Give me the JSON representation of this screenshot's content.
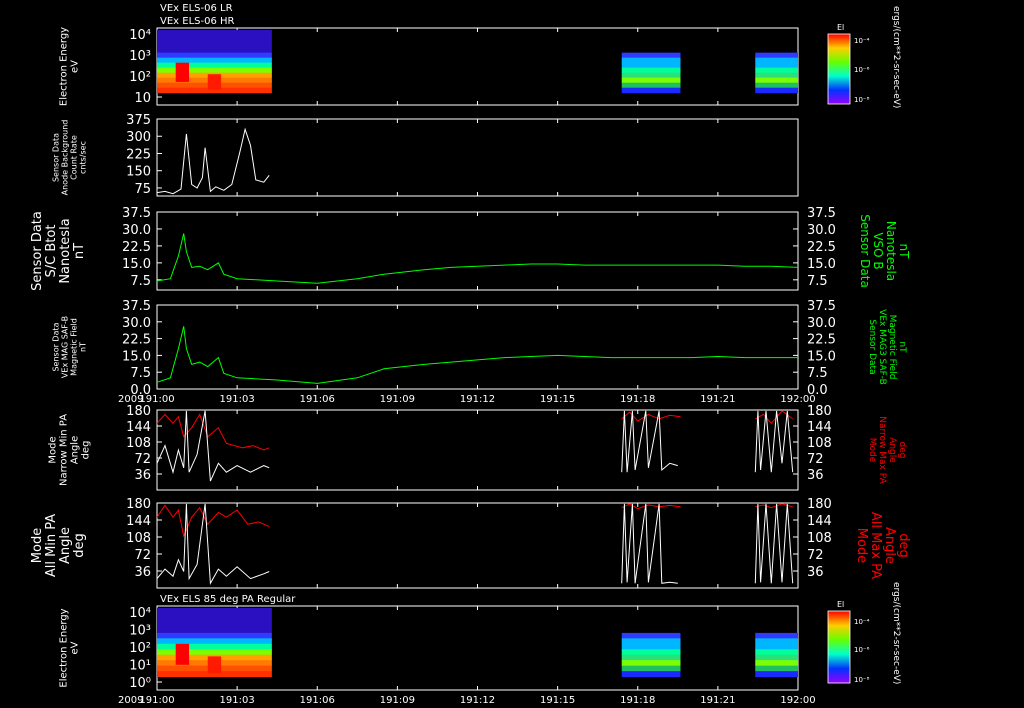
{
  "headers": {
    "top_line1": "VEx ELS-06 LR",
    "top_line2": "VEx ELS-06 HR",
    "bottom_title": "VEx ELS 85 deg PA Regular"
  },
  "colorbars": [
    {
      "title": "El",
      "ticks": [
        "10⁻⁴",
        "10⁻⁶",
        "10⁻⁸"
      ],
      "units": "ergs/(cm**2-sr-sec-eV)"
    },
    {
      "title": "El",
      "ticks": [
        "10⁻⁴",
        "10⁻⁶",
        "10⁻⁸"
      ],
      "units": "ergs/(cm**2-sr-sec-eV)"
    }
  ],
  "time_axis": {
    "year": "2009",
    "ticks": [
      "191:00",
      "191:03",
      "191:06",
      "191:09",
      "191:12",
      "191:15",
      "191:18",
      "191:21",
      "192:00"
    ],
    "range_hours": [
      0,
      1
    ]
  },
  "chart_data": [
    {
      "type": "heatmap",
      "panel": "els_lr_hr_spectrogram",
      "ylabel": [
        "Electron Energy",
        "eV"
      ],
      "yticks": [
        "10⁴",
        "10³",
        "10²",
        "10"
      ],
      "yscale": "log",
      "data_blocks_minutes": [
        [
          0,
          4.3
        ],
        [
          17.4,
          19.6
        ],
        [
          22.4,
          24
        ]
      ]
    },
    {
      "type": "line",
      "panel": "anode_background",
      "ylabel": [
        "Sensor Data",
        "Anode Background",
        "Count Rate",
        "cnts/sec"
      ],
      "yticks": [
        "375",
        "300",
        "225",
        "150",
        "75"
      ],
      "ylim": [
        40,
        375
      ],
      "series": [
        {
          "color": "#ffffff",
          "points": [
            [
              0.0,
              55
            ],
            [
              0.3,
              60
            ],
            [
              0.6,
              50
            ],
            [
              0.9,
              70
            ],
            [
              1.1,
              310
            ],
            [
              1.3,
              90
            ],
            [
              1.5,
              75
            ],
            [
              1.7,
              120
            ],
            [
              1.8,
              250
            ],
            [
              2.0,
              60
            ],
            [
              2.2,
              80
            ],
            [
              2.5,
              65
            ],
            [
              2.8,
              90
            ],
            [
              3.1,
              230
            ],
            [
              3.3,
              330
            ],
            [
              3.5,
              260
            ],
            [
              3.7,
              110
            ],
            [
              4.0,
              100
            ],
            [
              4.2,
              130
            ]
          ]
        }
      ]
    },
    {
      "type": "line",
      "panel": "mag_vso",
      "ylabel_left": [
        "Sensor Data",
        "S/C Btot",
        "Nanotesla",
        "nT"
      ],
      "ylabel_right": [
        "Sensor Data",
        "VSO B",
        "Nanotesla",
        "nT"
      ],
      "yticks": [
        "37.5",
        "30.0",
        "22.5",
        "15.0",
        "7.5"
      ],
      "ylim": [
        3,
        37.5
      ],
      "series": [
        {
          "color": "#00ff00",
          "points": [
            [
              0.0,
              7
            ],
            [
              0.5,
              8
            ],
            [
              0.8,
              18
            ],
            [
              1.0,
              28
            ],
            [
              1.1,
              20
            ],
            [
              1.3,
              13
            ],
            [
              1.6,
              13.5
            ],
            [
              1.9,
              12
            ],
            [
              2.3,
              15
            ],
            [
              2.5,
              10
            ],
            [
              3.0,
              8
            ],
            [
              4.5,
              7
            ],
            [
              6.0,
              6
            ],
            [
              7.5,
              8
            ],
            [
              8.5,
              10
            ],
            [
              10,
              12
            ],
            [
              11,
              13
            ],
            [
              12,
              13.5
            ],
            [
              13,
              14
            ],
            [
              14,
              14.5
            ],
            [
              15,
              14.5
            ],
            [
              16,
              14
            ],
            [
              17,
              14
            ],
            [
              18,
              14
            ],
            [
              19,
              14
            ],
            [
              20,
              14
            ],
            [
              21,
              14
            ],
            [
              22,
              13.5
            ],
            [
              23,
              13.5
            ],
            [
              24,
              13
            ]
          ]
        }
      ]
    },
    {
      "type": "line",
      "panel": "mag_saf_b",
      "ylabel_left": [
        "Sensor Data",
        "VEx MAG SAF-B",
        "Magnetic Field",
        "nT"
      ],
      "ylabel_right": [
        "Sensor Data",
        "VEx MAG3 SAF-B",
        "Magnetic Field",
        "nT"
      ],
      "yticks": [
        "37.5",
        "30.0",
        "22.5",
        "15.0",
        "7.5",
        "0.0"
      ],
      "ylim": [
        0,
        37.5
      ],
      "series": [
        {
          "color": "#00ff00",
          "points": [
            [
              0.0,
              3
            ],
            [
              0.5,
              5
            ],
            [
              0.8,
              18
            ],
            [
              1.0,
              28
            ],
            [
              1.1,
              18
            ],
            [
              1.3,
              11
            ],
            [
              1.6,
              12
            ],
            [
              1.9,
              10
            ],
            [
              2.3,
              14
            ],
            [
              2.5,
              7
            ],
            [
              3.0,
              5
            ],
            [
              4.5,
              4
            ],
            [
              6.0,
              2.5
            ],
            [
              7.5,
              5
            ],
            [
              8.5,
              9
            ],
            [
              10,
              11
            ],
            [
              11,
              12
            ],
            [
              12,
              13
            ],
            [
              13,
              14
            ],
            [
              14,
              14.5
            ],
            [
              15,
              15
            ],
            [
              16,
              14.5
            ],
            [
              17,
              14
            ],
            [
              18,
              14
            ],
            [
              19,
              14
            ],
            [
              20,
              14
            ],
            [
              21,
              14.5
            ],
            [
              22,
              14
            ],
            [
              23,
              14
            ],
            [
              24,
              14
            ]
          ]
        }
      ]
    },
    {
      "type": "line",
      "panel": "narrow_pa",
      "ylabel_left": [
        "Mode",
        "Narrow Min PA",
        "Angle",
        "deg"
      ],
      "ylabel_right": [
        "Mode",
        "Narrow Max PA",
        "Angle",
        "deg"
      ],
      "yticks": [
        "180",
        "144",
        "108",
        "72",
        "36"
      ],
      "ylim": [
        0,
        180
      ],
      "series": [
        {
          "name": "Narrow Max PA",
          "color": "#ff0000",
          "segments": [
            [
              [
                0.0,
                150
              ],
              [
                0.3,
                170
              ],
              [
                0.6,
                150
              ],
              [
                0.8,
                165
              ],
              [
                1.0,
                120
              ],
              [
                1.3,
                140
              ],
              [
                1.6,
                170
              ],
              [
                1.9,
                120
              ],
              [
                2.3,
                140
              ],
              [
                2.6,
                105
              ],
              [
                3.2,
                95
              ],
              [
                3.6,
                100
              ],
              [
                4.0,
                90
              ],
              [
                4.2,
                95
              ]
            ],
            [
              [
                17.4,
                160
              ],
              [
                17.7,
                175
              ],
              [
                18.0,
                155
              ],
              [
                18.4,
                170
              ],
              [
                18.8,
                160
              ],
              [
                19.2,
                168
              ],
              [
                19.6,
                165
              ]
            ],
            [
              [
                22.4,
                160
              ],
              [
                22.7,
                170
              ],
              [
                23.0,
                150
              ],
              [
                23.4,
                178
              ],
              [
                23.8,
                160
              ]
            ]
          ]
        },
        {
          "name": "Narrow Min PA",
          "color": "#ffffff",
          "segments": [
            [
              [
                0.0,
                60
              ],
              [
                0.3,
                100
              ],
              [
                0.6,
                40
              ],
              [
                0.8,
                90
              ],
              [
                1.0,
                50
              ],
              [
                1.1,
                178
              ],
              [
                1.2,
                40
              ],
              [
                1.5,
                80
              ],
              [
                1.8,
                178
              ],
              [
                2.0,
                20
              ],
              [
                2.3,
                60
              ],
              [
                2.6,
                40
              ],
              [
                3.0,
                55
              ],
              [
                3.5,
                40
              ],
              [
                4.0,
                55
              ],
              [
                4.2,
                50
              ]
            ],
            [
              [
                17.4,
                40
              ],
              [
                17.5,
                178
              ],
              [
                17.6,
                40
              ],
              [
                17.8,
                178
              ],
              [
                17.9,
                45
              ],
              [
                18.3,
                178
              ],
              [
                18.4,
                50
              ],
              [
                18.8,
                178
              ],
              [
                18.9,
                45
              ],
              [
                19.2,
                60
              ],
              [
                19.5,
                55
              ]
            ],
            [
              [
                22.4,
                40
              ],
              [
                22.5,
                178
              ],
              [
                22.6,
                45
              ],
              [
                22.8,
                178
              ],
              [
                23.0,
                40
              ],
              [
                23.2,
                178
              ],
              [
                23.4,
                60
              ],
              [
                23.6,
                178
              ],
              [
                23.8,
                40
              ]
            ]
          ]
        }
      ]
    },
    {
      "type": "line",
      "panel": "all_pa",
      "ylabel_left": [
        "Mode",
        "All Min PA",
        "Angle",
        "deg"
      ],
      "ylabel_right": [
        "Mode",
        "All Max PA",
        "Angle",
        "deg"
      ],
      "yticks": [
        "180",
        "144",
        "108",
        "72",
        "36"
      ],
      "ylim": [
        0,
        180
      ],
      "series": [
        {
          "name": "All Max PA",
          "color": "#ff0000",
          "segments": [
            [
              [
                0.0,
                150
              ],
              [
                0.3,
                175
              ],
              [
                0.6,
                150
              ],
              [
                0.8,
                165
              ],
              [
                1.0,
                110
              ],
              [
                1.3,
                150
              ],
              [
                1.6,
                170
              ],
              [
                1.9,
                135
              ],
              [
                2.3,
                160
              ],
              [
                2.6,
                150
              ],
              [
                3.0,
                165
              ],
              [
                3.4,
                135
              ],
              [
                3.8,
                140
              ],
              [
                4.2,
                130
              ]
            ],
            [
              [
                17.4,
                170
              ],
              [
                17.7,
                178
              ],
              [
                18.0,
                168
              ],
              [
                18.4,
                176
              ],
              [
                18.8,
                172
              ],
              [
                19.2,
                175
              ],
              [
                19.6,
                172
              ]
            ],
            [
              [
                22.4,
                172
              ],
              [
                22.7,
                176
              ],
              [
                23.0,
                170
              ],
              [
                23.4,
                178
              ],
              [
                23.8,
                172
              ]
            ]
          ]
        },
        {
          "name": "All Min PA",
          "color": "#ffffff",
          "segments": [
            [
              [
                0.0,
                20
              ],
              [
                0.3,
                40
              ],
              [
                0.6,
                25
              ],
              [
                0.8,
                60
              ],
              [
                1.0,
                35
              ],
              [
                1.1,
                178
              ],
              [
                1.2,
                20
              ],
              [
                1.5,
                50
              ],
              [
                1.8,
                178
              ],
              [
                2.0,
                10
              ],
              [
                2.3,
                40
              ],
              [
                2.6,
                25
              ],
              [
                3.0,
                45
              ],
              [
                3.5,
                20
              ],
              [
                4.0,
                30
              ],
              [
                4.2,
                35
              ]
            ],
            [
              [
                17.4,
                10
              ],
              [
                17.5,
                178
              ],
              [
                17.6,
                12
              ],
              [
                17.8,
                178
              ],
              [
                17.9,
                10
              ],
              [
                18.3,
                178
              ],
              [
                18.4,
                12
              ],
              [
                18.8,
                178
              ],
              [
                18.9,
                10
              ],
              [
                19.2,
                12
              ],
              [
                19.5,
                10
              ]
            ],
            [
              [
                22.4,
                10
              ],
              [
                22.5,
                178
              ],
              [
                22.6,
                12
              ],
              [
                22.8,
                178
              ],
              [
                23.0,
                10
              ],
              [
                23.2,
                178
              ],
              [
                23.4,
                12
              ],
              [
                23.6,
                178
              ],
              [
                23.8,
                10
              ]
            ]
          ]
        }
      ]
    },
    {
      "type": "heatmap",
      "panel": "els_85deg_spectrogram",
      "ylabel": [
        "Electron Energy",
        "eV"
      ],
      "yticks": [
        "10⁴",
        "10³",
        "10²",
        "10¹",
        "10⁰"
      ],
      "yscale": "log",
      "data_blocks_minutes": [
        [
          0,
          4.3
        ],
        [
          17.4,
          19.6
        ],
        [
          22.4,
          24
        ]
      ]
    }
  ]
}
